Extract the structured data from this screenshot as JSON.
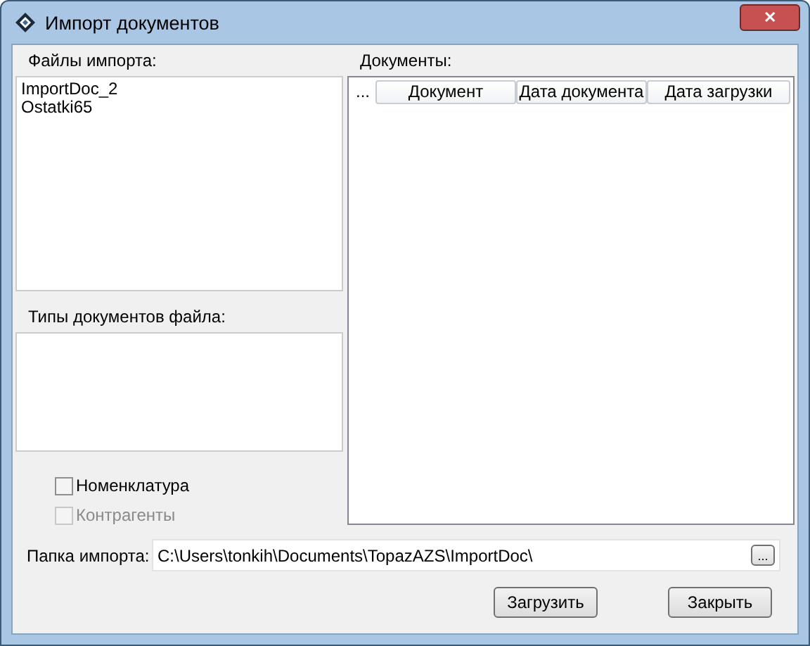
{
  "window": {
    "title": "Импорт документов",
    "close": "✕"
  },
  "files": {
    "label": "Файлы импорта:",
    "items": [
      "ImportDoc_2",
      "Ostatki65"
    ]
  },
  "types": {
    "label": "Типы документов файла:"
  },
  "checkboxes": [
    {
      "label": "Номенклатура",
      "checked": false,
      "disabled": false
    },
    {
      "label": "Контрагенты",
      "checked": false,
      "disabled": true
    }
  ],
  "documents": {
    "label": "Документы:",
    "columns": [
      "...",
      "Документ",
      "Дата документа",
      "Дата загрузки"
    ]
  },
  "folder": {
    "label": "Папка импорта:",
    "value": "C:\\Users\\tonkih\\Documents\\TopazAZS\\ImportDoc\\",
    "browse": "..."
  },
  "buttons": [
    "Загрузить",
    "Закрыть"
  ]
}
